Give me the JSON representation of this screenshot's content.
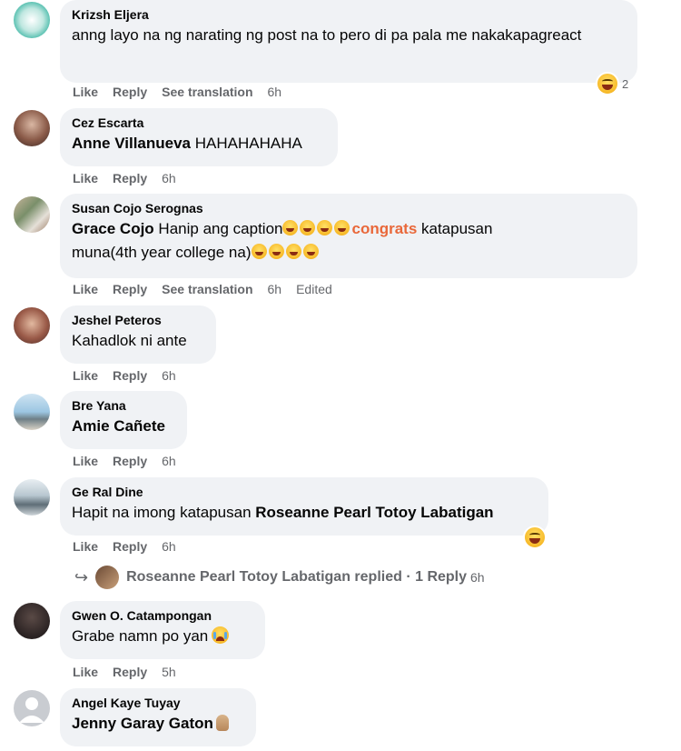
{
  "actions": {
    "like": "Like",
    "reply": "Reply",
    "see_translation": "See translation",
    "edited": "Edited"
  },
  "comments": [
    {
      "author": "Krizsh Eljera",
      "text": "anng layo na ng narating ng post na to pero di pa pala me nakakapagreact",
      "time": "6h",
      "reaction_count": "2"
    },
    {
      "author": "Cez Escarta",
      "mention": "Anne Villanueva",
      "text": " HAHAHAHAHA",
      "time": "6h"
    },
    {
      "author": "Susan Cojo Serognas",
      "mention": "Grace Cojo",
      "text_a": " Hanip ang caption",
      "highlight": "congrats",
      "text_b": " katapusan",
      "text_c": "muna(4th year college na)",
      "time": "6h"
    },
    {
      "author": "Jeshel Peteros",
      "text": "Kahadlok ni ante",
      "time": "6h"
    },
    {
      "author": "Bre Yana",
      "mention": "Amie Cañete",
      "time": "6h"
    },
    {
      "author": "Ge Ral Dine",
      "text": "Hapit na imong katapusan ",
      "mention": "Roseanne Pearl Totoy Labatigan",
      "time": "6h"
    },
    {
      "author": "Gwen O. Catampongan",
      "text": "Grabe namn po yan",
      "time": "5h"
    },
    {
      "author": "Angel Kaye Tuyay",
      "mention": "Jenny Garay Gaton"
    }
  ],
  "reply_summary": {
    "name": "Roseanne Pearl Totoy Labatigan",
    "replied": " replied · ",
    "count": "1 Reply",
    "time": "6h"
  },
  "icons": {
    "reaction": "haha-emoji-icon",
    "reply_arrow": "reply-arrow-icon",
    "cry": "crying-emoji-icon",
    "pray": "pray-emoji-icon"
  }
}
